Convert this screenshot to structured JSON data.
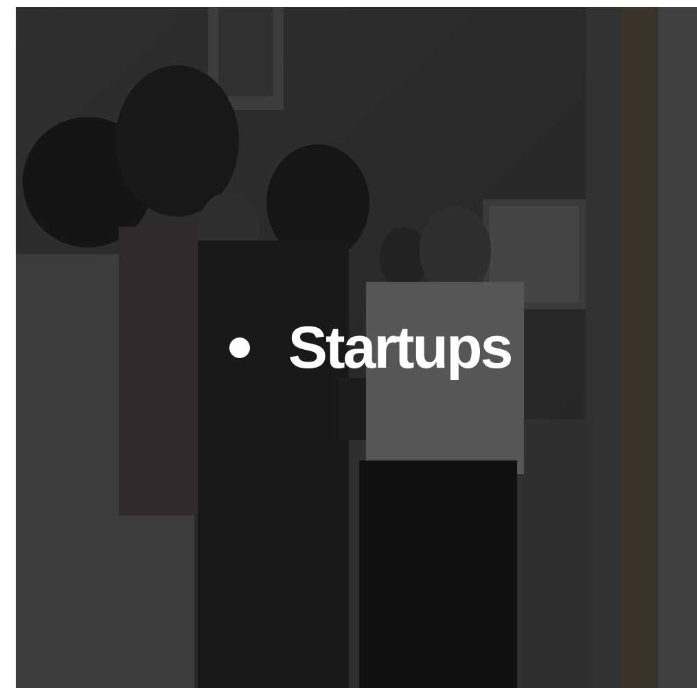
{
  "slide": {
    "title": "Startups",
    "bullet_icon": "bullet-dot-icon",
    "text_color": "#ffffff",
    "overlay_color": "#000000",
    "photo_description_icon": "group-photo-image"
  }
}
